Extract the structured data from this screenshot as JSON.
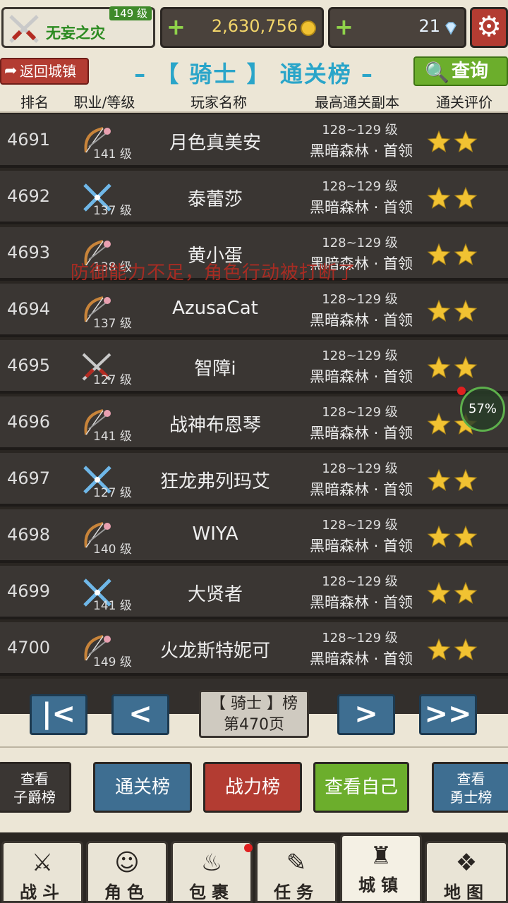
{
  "player": {
    "name": "无妄之灾",
    "level_badge": "149 级"
  },
  "currency": {
    "gold": "2,630,756",
    "gems": "21",
    "plus": "+"
  },
  "header": {
    "back_label": "返回城镇",
    "title": "– 【 骑士 】 通关榜 –",
    "search_label": "查询"
  },
  "columns": [
    "排名",
    "职业/等级",
    "玩家名称",
    "最高通关副本",
    "通关评价"
  ],
  "rows": [
    {
      "rank": "4691",
      "job": "bow",
      "level": "141 级",
      "name": "月色真美安",
      "dungeon_level": "128~129 级",
      "dungeon": "黑暗森林 · 首领",
      "stars": 2
    },
    {
      "rank": "4692",
      "job": "cross",
      "level": "137 级",
      "name": "泰蕾莎",
      "dungeon_level": "128~129 级",
      "dungeon": "黑暗森林 · 首领",
      "stars": 2
    },
    {
      "rank": "4693",
      "job": "bow",
      "level": "138 级",
      "name": "黄小蛋",
      "dungeon_level": "128~129 级",
      "dungeon": "黑暗森林 · 首领",
      "stars": 2
    },
    {
      "rank": "4694",
      "job": "bow",
      "level": "137 级",
      "name": "AzusaCat",
      "dungeon_level": "128~129 级",
      "dungeon": "黑暗森林 · 首领",
      "stars": 2
    },
    {
      "rank": "4695",
      "job": "swords",
      "level": "127 级",
      "name": "智障i",
      "dungeon_level": "128~129 级",
      "dungeon": "黑暗森林 · 首领",
      "stars": 2
    },
    {
      "rank": "4696",
      "job": "bow",
      "level": "141 级",
      "name": "战神布恩琴",
      "dungeon_level": "128~129 级",
      "dungeon": "黑暗森林 · 首领",
      "stars": 2
    },
    {
      "rank": "4697",
      "job": "cross",
      "level": "127 级",
      "name": "狂龙弗列玛艾",
      "dungeon_level": "128~129 级",
      "dungeon": "黑暗森林 · 首领",
      "stars": 2
    },
    {
      "rank": "4698",
      "job": "bow",
      "level": "140 级",
      "name": "WIYA",
      "dungeon_level": "128~129 级",
      "dungeon": "黑暗森林 · 首领",
      "stars": 2
    },
    {
      "rank": "4699",
      "job": "cross",
      "level": "141 级",
      "name": "大贤者",
      "dungeon_level": "128~129 级",
      "dungeon": "黑暗森林 · 首领",
      "stars": 2
    },
    {
      "rank": "4700",
      "job": "bow",
      "level": "149 级",
      "name": "火龙斯特妮可",
      "dungeon_level": "128~129 级",
      "dungeon": "黑暗森林 · 首领",
      "stars": 2
    }
  ],
  "notice": "防御能力不足，角色行动被打断了",
  "progress": {
    "label": "57%",
    "value": 57
  },
  "pager": {
    "first": "|<",
    "prev": "<",
    "next": ">",
    "last": ">>",
    "board_line": "【 骑士 】榜",
    "page_line": "第470页"
  },
  "boards": {
    "viscount": [
      "查看",
      "子爵榜"
    ],
    "clear": "通关榜",
    "power": "战力榜",
    "self": "查看自己",
    "brave": [
      "查看",
      "勇士榜"
    ]
  },
  "nav": [
    {
      "key": "battle",
      "label": "战斗",
      "icon": "battle-icon"
    },
    {
      "key": "character",
      "label": "角色",
      "icon": "character-icon"
    },
    {
      "key": "bag",
      "label": "包裹",
      "icon": "bag-icon"
    },
    {
      "key": "quest",
      "label": "任务",
      "icon": "quest-icon"
    },
    {
      "key": "town",
      "label": "城镇",
      "icon": "town-icon"
    },
    {
      "key": "map",
      "label": "地图",
      "icon": "map-icon"
    }
  ],
  "colors": {
    "accent_blue": "#2aa5c9",
    "button_red": "#b33c32",
    "button_green": "#6cae2c",
    "button_blue": "#3e6e91",
    "star": "#f1c232"
  }
}
